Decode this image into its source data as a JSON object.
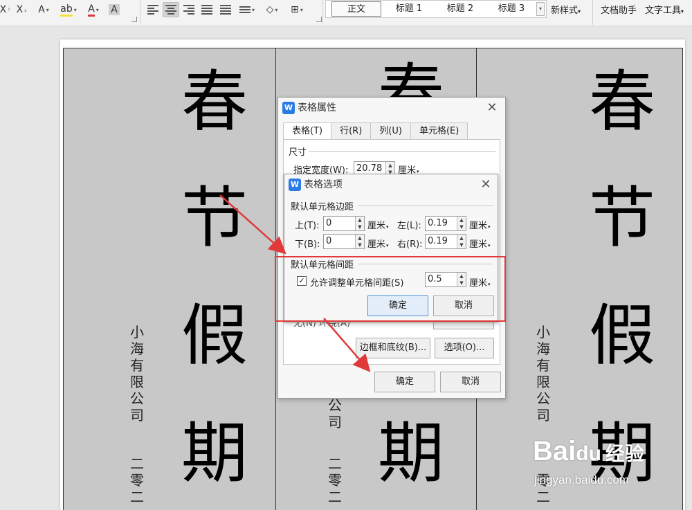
{
  "toolbar": {
    "styles": [
      "正文",
      "标题 1",
      "标题 2",
      "标题 3"
    ],
    "new_style": "新样式",
    "doc_assistant": "文档助手",
    "text_tools": "文字工具"
  },
  "document": {
    "big_chars": [
      "春",
      "节",
      "假",
      "期"
    ],
    "vertical_company": "小海有限公司",
    "vertical_date": "二零二",
    "cell2_company_partial": "公司",
    "cell2_date_partial": "二零二",
    "cell3_date_partial": "零二"
  },
  "table_props": {
    "title": "表格属性",
    "tabs": [
      "表格(T)",
      "行(R)",
      "列(U)",
      "单元格(E)"
    ],
    "size_section": "尺寸",
    "width_label": "指定宽度(W):",
    "width_value": "20.78",
    "width_unit": "厘米",
    "wrap_partial": "无(N)        环绕(A)",
    "borders_button": "边框和底纹(B)...",
    "options_button": "选项(O)...",
    "ok_button": "确定",
    "cancel_button": "取消"
  },
  "table_options": {
    "title": "表格选项",
    "margins_section": "默认单元格边距",
    "top_label": "上(T):",
    "top_value": "0",
    "bottom_label": "下(B):",
    "bottom_value": "0",
    "left_label": "左(L):",
    "left_value": "0.19",
    "right_label": "右(R):",
    "right_value": "0.19",
    "unit": "厘米",
    "spacing_section": "默认单元格间距",
    "allow_spacing_label": "允许调整单元格间距(S)",
    "allow_spacing_checked": true,
    "spacing_value": "0.5",
    "ok_button": "确定",
    "cancel_button": "取消"
  },
  "watermark": {
    "brand": "Bai",
    "brand_suffix": "经验",
    "url": "jingyan.baidu.com"
  },
  "colors": {
    "annotation_red": "#e0393a",
    "wps_blue": "#2b7be6",
    "cell_gray": "#c8c8c8"
  }
}
